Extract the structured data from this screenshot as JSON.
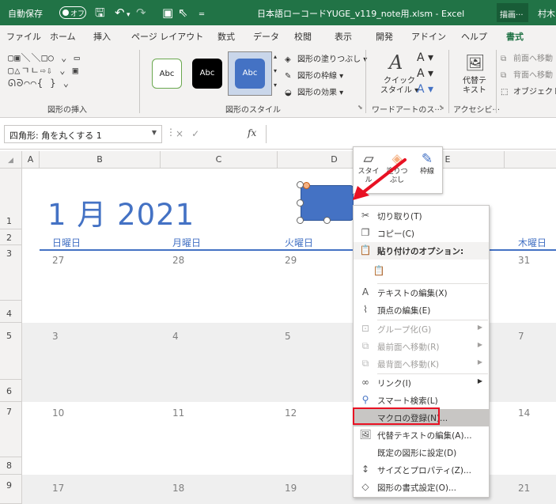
{
  "titlebar": {
    "autosave_label": "自動保存",
    "autosave_state": "オフ",
    "document_title": "日本語ローコードYUGE_v119_note用.xlsm  -  Excel",
    "right_tab": "描画···",
    "user": "村木"
  },
  "menu": {
    "tabs": [
      "ファイル",
      "ホーム",
      "挿入",
      "ページ レイアウト",
      "数式",
      "データ",
      "校閲",
      "表示",
      "開発",
      "アドイン",
      "ヘルプ",
      "書式"
    ],
    "active_tab": "書式"
  },
  "ribbon": {
    "insert_shapes_label": "図形の挿入",
    "shapes_rows": [
      "▢▣＼＼□○ ⌄ ▭",
      "▢△ㄱㄴ⇨⇩ ⌄ ▣",
      "ᘏᘐ⌒⌒{ } ⌄"
    ],
    "style_samples": [
      "Abc",
      "Abc",
      "Abc"
    ],
    "shape_styles_label": "図形のスタイル",
    "fill_label": "図形の塗りつぶし",
    "outline_label": "図形の枠線",
    "effects_label": "図形の効果",
    "quick_style_label1": "クイック",
    "quick_style_label2": "スタイル",
    "wordart_label": "ワードアートのス···",
    "alt_text_label1": "代替テ",
    "alt_text_label2": "キスト",
    "accessibility_label": "アクセシビ···",
    "bring_forward": "前面へ移動",
    "send_backward": "背面へ移動",
    "selection_pane": "オブジェクト"
  },
  "formula_bar": {
    "name_box": "四角形: 角を丸くする 1",
    "fx": "fx",
    "cancel": "×",
    "enter": "✓"
  },
  "grid": {
    "columns": [
      "A",
      "B",
      "C",
      "D",
      "E"
    ],
    "rows": [
      "1",
      "2",
      "3",
      "4",
      "5",
      "6",
      "7",
      "8",
      "9"
    ]
  },
  "calendar": {
    "title": "1 月 2021",
    "day_names": [
      "日曜日",
      "月曜日",
      "火曜日",
      "木曜日"
    ],
    "week1": [
      "27",
      "28",
      "29",
      "31"
    ],
    "week2": [
      "3",
      "4",
      "5",
      "7"
    ],
    "week3": [
      "10",
      "11",
      "12",
      "14"
    ],
    "week4": [
      "17",
      "18",
      "19",
      "21"
    ]
  },
  "mini_toolbar": {
    "style": "スタイル",
    "fill1": "塗りつ",
    "fill2": "ぶし",
    "outline": "枠線"
  },
  "context_menu": {
    "cut": "切り取り(T)",
    "copy": "コピー(C)",
    "paste_options": "貼り付けのオプション:",
    "edit_text": "テキストの編集(X)",
    "edit_points": "頂点の編集(E)",
    "group": "グループ化(G)",
    "bring_front": "最前面へ移動(R)",
    "send_back": "最背面へ移動(K)",
    "link": "リンク(I)",
    "smart_lookup": "スマート検索(L)",
    "assign_macro": "マクロの登録(N)...",
    "edit_alt_text": "代替テキストの編集(A)...",
    "set_default": "既定の図形に設定(D)",
    "size_properties": "サイズとプロパティ(Z)...",
    "format_shape": "図形の書式設定(O)..."
  },
  "colors": {
    "excel_green": "#217346",
    "accent_blue": "#4472c4",
    "annotation_red": "#e81123"
  }
}
